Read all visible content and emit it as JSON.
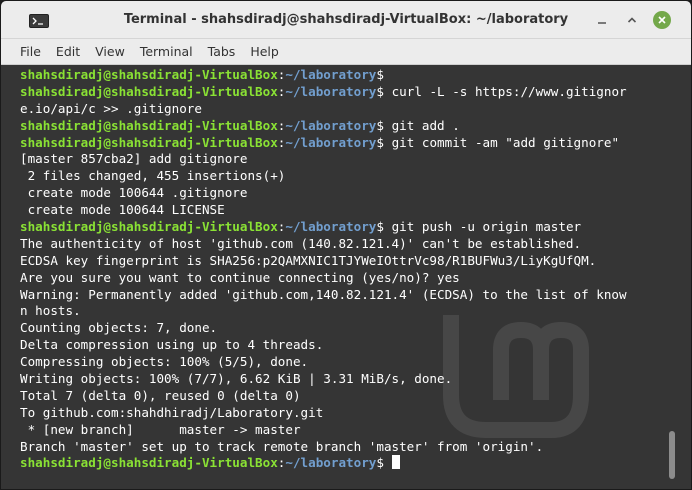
{
  "window": {
    "title": "Terminal - shahsdiradj@shahsdiradj-VirtualBox: ~/laboratory"
  },
  "menu": [
    "File",
    "Edit",
    "View",
    "Terminal",
    "Tabs",
    "Help"
  ],
  "prompt": {
    "user": "shahsdiradj@shahsdiradj-VirtualBox",
    "sep": ":",
    "path": "~/laboratory",
    "symbol": "$"
  },
  "lines": [
    {
      "type": "prompt",
      "cmd": ""
    },
    {
      "type": "prompt",
      "cmd": " curl -L -s https://www.gitignor"
    },
    {
      "type": "out",
      "text": "e.io/api/c >> .gitignore"
    },
    {
      "type": "prompt",
      "cmd": " git add ."
    },
    {
      "type": "prompt",
      "cmd": " git commit -am \"add gitignore\""
    },
    {
      "type": "out",
      "text": "[master 857cba2] add gitignore"
    },
    {
      "type": "out",
      "text": " 2 files changed, 455 insertions(+)"
    },
    {
      "type": "out",
      "text": " create mode 100644 .gitignore"
    },
    {
      "type": "out",
      "text": " create mode 100644 LICENSE"
    },
    {
      "type": "prompt",
      "cmd": " git push -u origin master"
    },
    {
      "type": "out",
      "text": "The authenticity of host 'github.com (140.82.121.4)' can't be established."
    },
    {
      "type": "out",
      "text": "ECDSA key fingerprint is SHA256:p2QAMXNIC1TJYWeIOttrVc98/R1BUFWu3/LiyKgUfQM."
    },
    {
      "type": "out",
      "text": "Are you sure you want to continue connecting (yes/no)? yes"
    },
    {
      "type": "out",
      "text": "Warning: Permanently added 'github.com,140.82.121.4' (ECDSA) to the list of know"
    },
    {
      "type": "out",
      "text": "n hosts."
    },
    {
      "type": "out",
      "text": "Counting objects: 7, done."
    },
    {
      "type": "out",
      "text": "Delta compression using up to 4 threads."
    },
    {
      "type": "out",
      "text": "Compressing objects: 100% (5/5), done."
    },
    {
      "type": "out",
      "text": "Writing objects: 100% (7/7), 6.62 KiB | 3.31 MiB/s, done."
    },
    {
      "type": "out",
      "text": "Total 7 (delta 0), reused 0 (delta 0)"
    },
    {
      "type": "out",
      "text": "To github.com:shahdhiradj/Laboratory.git"
    },
    {
      "type": "out",
      "text": " * [new branch]      master -> master"
    },
    {
      "type": "out",
      "text": "Branch 'master' set up to track remote branch 'master' from 'origin'."
    },
    {
      "type": "prompt",
      "cmd": " ",
      "cursor": true
    }
  ]
}
